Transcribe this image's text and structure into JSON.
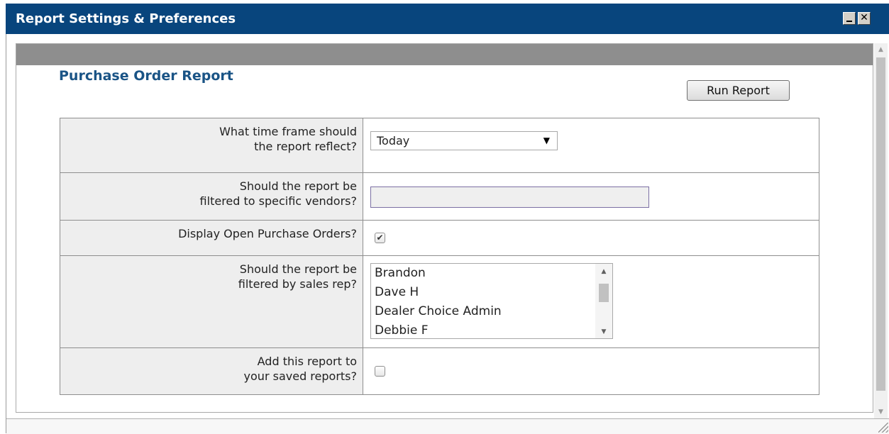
{
  "window": {
    "title": "Report Settings & Preferences",
    "close_glyph": "✕"
  },
  "report": {
    "title": "Purchase Order Report",
    "run_button": "Run Report"
  },
  "fields": {
    "time_frame": {
      "label_line1": "What time frame should",
      "label_line2": "the report reflect?",
      "value": "Today",
      "arrow": "▼"
    },
    "vendors": {
      "label_line1": "Should the report be",
      "label_line2": "filtered to specific vendors?",
      "value": ""
    },
    "open_pos": {
      "label": "Display Open Purchase Orders?",
      "checked": true,
      "check_glyph": "✔"
    },
    "sales_rep": {
      "label_line1": "Should the report be",
      "label_line2": "filtered by sales rep?",
      "options": [
        "Brandon",
        "Dave H",
        "Dealer Choice Admin",
        "Debbie F"
      ]
    },
    "saved": {
      "label_line1": "Add this report to",
      "label_line2": "your saved reports?",
      "checked": false
    }
  },
  "icons": {
    "minimize": "minimize-icon",
    "close": "close-icon",
    "scroll_up": "▲",
    "scroll_down": "▼"
  }
}
